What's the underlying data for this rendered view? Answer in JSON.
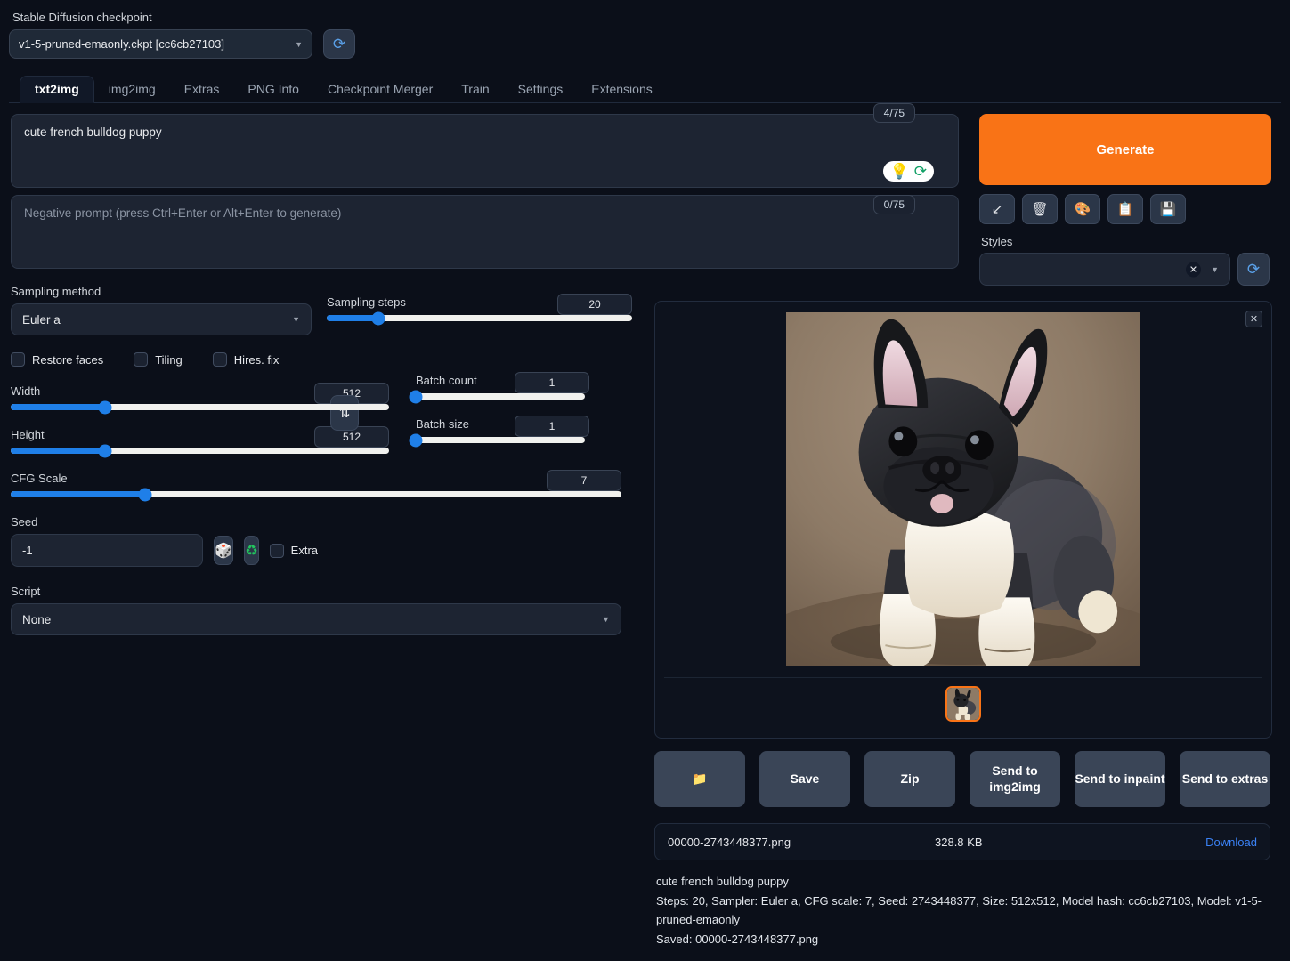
{
  "checkpoint": {
    "label": "Stable Diffusion checkpoint",
    "value": "v1-5-pruned-emaonly.ckpt [cc6cb27103]",
    "refresh_icon": "refresh-icon"
  },
  "tabs": [
    {
      "label": "txt2img",
      "active": true
    },
    {
      "label": "img2img",
      "active": false
    },
    {
      "label": "Extras",
      "active": false
    },
    {
      "label": "PNG Info",
      "active": false
    },
    {
      "label": "Checkpoint Merger",
      "active": false
    },
    {
      "label": "Train",
      "active": false
    },
    {
      "label": "Settings",
      "active": false
    },
    {
      "label": "Extensions",
      "active": false
    }
  ],
  "prompt": {
    "value": "cute french bulldog puppy",
    "token_count": "4/75",
    "tools": [
      "lightbulb-icon",
      "restore-progress-icon"
    ]
  },
  "negative_prompt": {
    "placeholder": "Negative prompt (press Ctrl+Enter or Alt+Enter to generate)",
    "token_count": "0/75"
  },
  "generate": {
    "label": "Generate"
  },
  "mini_buttons": [
    {
      "name": "paste-params-button",
      "glyph": "↙"
    },
    {
      "name": "clear-prompt-button",
      "glyph": "🗑"
    },
    {
      "name": "apply-style-button",
      "glyph": "🎨"
    },
    {
      "name": "copy-style-button",
      "glyph": "📋"
    },
    {
      "name": "save-style-button",
      "glyph": "💾"
    }
  ],
  "styles": {
    "label": "Styles",
    "value": "",
    "clear_glyph": "✕",
    "refresh_icon": "refresh-icon"
  },
  "sampling": {
    "method_label": "Sampling method",
    "method_value": "Euler a",
    "steps_label": "Sampling steps",
    "steps_value": "20",
    "steps_percent": 17
  },
  "toggles": [
    {
      "label": "Restore faces",
      "checked": false
    },
    {
      "label": "Tiling",
      "checked": false
    },
    {
      "label": "Hires. fix",
      "checked": false
    }
  ],
  "dimensions": {
    "width_label": "Width",
    "width_value": "512",
    "width_percent": 25,
    "height_label": "Height",
    "height_value": "512",
    "height_percent": 25,
    "swap_glyph": "⇅"
  },
  "batch": {
    "count_label": "Batch count",
    "count_value": "1",
    "count_percent": 0,
    "size_label": "Batch size",
    "size_value": "1",
    "size_percent": 0
  },
  "cfg": {
    "label": "CFG Scale",
    "value": "7",
    "percent": 22
  },
  "seed": {
    "label": "Seed",
    "value": "-1",
    "random_glyph": "🎲",
    "reuse_glyph": "♻",
    "extra_label": "Extra",
    "extra_checked": false
  },
  "script": {
    "label": "Script",
    "value": "None"
  },
  "result": {
    "close_glyph": "✕",
    "image_alt": "generated-french-bulldog-puppy",
    "actions": [
      {
        "name": "open-folder-button",
        "label": "📁"
      },
      {
        "name": "save-button",
        "label": "Save"
      },
      {
        "name": "zip-button",
        "label": "Zip"
      },
      {
        "name": "send-to-img2img-button",
        "label": "Send to img2img"
      },
      {
        "name": "send-to-inpaint-button",
        "label": "Send to inpaint"
      },
      {
        "name": "send-to-extras-button",
        "label": "Send to extras"
      }
    ],
    "file": {
      "name": "00000-2743448377.png",
      "size": "328.8 KB",
      "download_label": "Download"
    },
    "meta_prompt": "cute french bulldog puppy",
    "meta_params": "Steps: 20, Sampler: Euler a, CFG scale: 7, Seed: 2743448377, Size: 512x512, Model hash: cc6cb27103, Model: v1-5-pruned-emaonly",
    "meta_saved": "Saved: 00000-2743448377.png"
  },
  "colors": {
    "accent_orange": "#f97316",
    "slider_blue": "#1f7fe8",
    "link_blue": "#3b82f6",
    "background": "#0b0f19"
  }
}
